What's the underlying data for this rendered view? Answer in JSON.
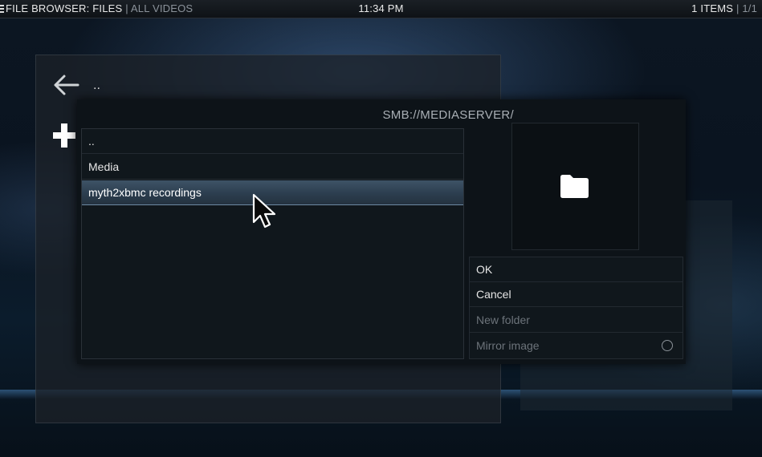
{
  "topbar": {
    "title": "FILE BROWSER: FILES",
    "separator": "|",
    "section": "ALL VIDEOS",
    "time": "11:34 PM",
    "items_count": "1 ITEMS",
    "page": "1/1"
  },
  "background": {
    "back_label": ".."
  },
  "dialog": {
    "path": "SMB://MEDIASERVER/",
    "items": [
      {
        "label": ".."
      },
      {
        "label": "Media"
      },
      {
        "label": "myth2xbmc recordings"
      }
    ],
    "selected_index": 2,
    "buttons": {
      "ok": "OK",
      "cancel": "Cancel",
      "new_folder": "New folder",
      "mirror_image": "Mirror image"
    }
  },
  "icons": [
    "menu-icon",
    "back-arrow-icon",
    "plus-icon",
    "folder-icon",
    "radio-icon",
    "mouse-cursor-icon"
  ],
  "colors": {
    "selection": "#3e5366",
    "text": "#e6e6e6",
    "disabled_text": "#6c737a"
  }
}
